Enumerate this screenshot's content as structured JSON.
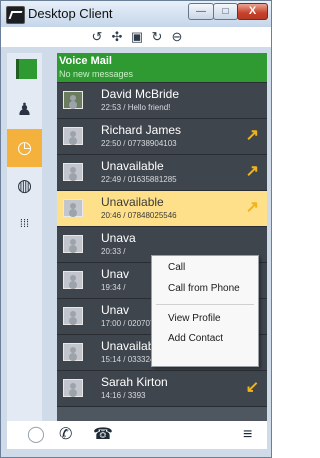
{
  "window": {
    "title": "Desktop Client"
  },
  "title_buttons": {
    "minimize": "—",
    "maximize": "□",
    "close": "X"
  },
  "toolbar": [
    {
      "icon": "phone-forward-icon",
      "glyph": "↺"
    },
    {
      "icon": "transfer-icon",
      "glyph": "✣"
    },
    {
      "icon": "call-park-icon",
      "glyph": "▣"
    },
    {
      "icon": "callback-icon",
      "glyph": "↻"
    },
    {
      "icon": "do-not-disturb-icon",
      "glyph": "⊖"
    }
  ],
  "sidebar": [
    {
      "icon": "voicemail-flag-icon",
      "glyph": "",
      "active": false
    },
    {
      "icon": "contacts-icon",
      "glyph": "♟",
      "active": false
    },
    {
      "icon": "history-clock-icon",
      "glyph": "◷",
      "active": true
    },
    {
      "icon": "globe-icon",
      "glyph": "◍",
      "active": false
    },
    {
      "icon": "dialpad-icon",
      "glyph": "⁞⁞⁞",
      "active": false
    }
  ],
  "voicemail": {
    "title": "Voice Mail",
    "subtitle": "No new messages"
  },
  "calls": [
    {
      "name": "David McBride",
      "detail": "22:53 / Hello friend!",
      "avatar": "photo",
      "arrow": "",
      "type": "none"
    },
    {
      "name": "Richard James",
      "detail": "22:50 / 07738904103",
      "avatar": "default",
      "arrow": "↗",
      "type": "outgoing"
    },
    {
      "name": "Unavailable",
      "detail": "22:49 / 01635881285",
      "avatar": "default",
      "arrow": "↗",
      "type": "outgoing"
    },
    {
      "name": "Unavailable",
      "detail": "20:46 / 07848025546",
      "avatar": "default",
      "arrow": "↗",
      "type": "outgoing",
      "selected": true
    },
    {
      "name": "Unava",
      "detail": "20:33 /",
      "avatar": "default",
      "arrow": "",
      "type": "none"
    },
    {
      "name": "Unav",
      "detail": "19:34 /",
      "avatar": "default",
      "arrow": "",
      "type": "none"
    },
    {
      "name": "Unav",
      "detail": "17:00 / 02070704543",
      "avatar": "default",
      "arrow": "↗",
      "type": "outgoing"
    },
    {
      "name": "Unavailable",
      "detail": "15:14 / 03332403236",
      "avatar": "default",
      "arrow": "↘",
      "type": "missed"
    },
    {
      "name": "Sarah Kirton",
      "detail": "14:16 / 3393",
      "avatar": "default",
      "arrow": "↙",
      "type": "incoming"
    }
  ],
  "context_menu": {
    "call": "Call",
    "call_from_phone": "Call from Phone",
    "view_profile": "View Profile",
    "add_contact": "Add Contact"
  },
  "bottombar": [
    {
      "icon": "chat-icon",
      "glyph": "◯"
    },
    {
      "icon": "phone-icon",
      "glyph": "✆"
    },
    {
      "icon": "desk-phone-icon",
      "glyph": "☎"
    },
    {
      "icon": "menu-icon",
      "glyph": "≡"
    }
  ],
  "colors": {
    "accent": "#f4b23c",
    "voicemail_green": "#2f9a32",
    "row_dark": "#3f454d",
    "selected_row": "#ffe08a",
    "outgoing_arrow": "#f2b318",
    "missed_arrow": "#e23b2a"
  }
}
